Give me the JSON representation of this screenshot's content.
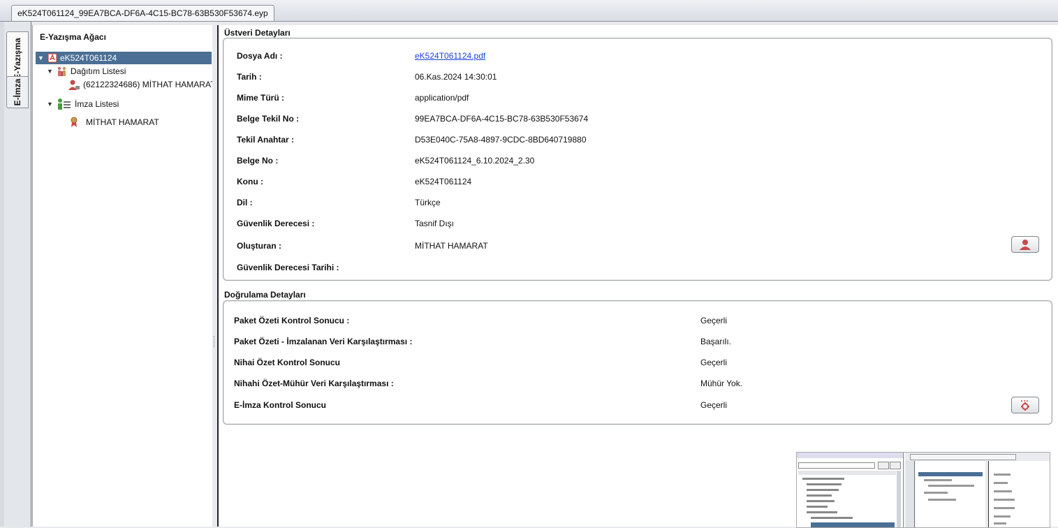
{
  "window": {
    "file_tab": "eK524T061124_99EA7BCA-DF6A-4C15-BC78-63B530F53674.eyp"
  },
  "side_tabs": [
    "E-Yazışma",
    "E-İmza"
  ],
  "tree": {
    "title": "E-Yazışma Ağacı",
    "root": "eK524T061124",
    "distribution_list": "Dağıtım Listesi",
    "distribution_item": "(62122324686) MİTHAT HAMARAT",
    "signature_list": "İmza Listesi",
    "signature_item": "MİTHAT HAMARAT"
  },
  "metadata": {
    "title": "Üstveri Detayları",
    "rows": [
      {
        "label": "Dosya Adı :",
        "value": "eK524T061124.pdf",
        "link": true
      },
      {
        "label": "Tarih :",
        "value": "06.Kas.2024 14:30:01"
      },
      {
        "label": "Mime Türü :",
        "value": "application/pdf"
      },
      {
        "label": "Belge Tekil No :",
        "value": "99EA7BCA-DF6A-4C15-BC78-63B530F53674"
      },
      {
        "label": "Tekil Anahtar :",
        "value": "D53E040C-75A8-4897-9CDC-8BD640719880"
      },
      {
        "label": "Belge No :",
        "value": "eK524T061124_6.10.2024_2.30"
      },
      {
        "label": "Konu :",
        "value": "eK524T061124"
      },
      {
        "label": "Dil :",
        "value": "Türkçe"
      },
      {
        "label": "Güvenlik Derecesi :",
        "value": "Tasnif Dışı"
      },
      {
        "label": "Oluşturan :",
        "value": "MİTHAT HAMARAT"
      },
      {
        "label": "Güvenlik Derecesi Tarihi :",
        "value": ""
      }
    ]
  },
  "verification": {
    "title": "Doğrulama Detayları",
    "rows": [
      {
        "label": "Paket Özeti Kontrol Sonucu :",
        "value": "Geçerli"
      },
      {
        "label": "Paket Özeti - İmzalanan Veri Karşılaştırması :",
        "value": "Başarılı."
      },
      {
        "label": "Nihai Özet Kontrol Sonucu",
        "value": "Geçerli"
      },
      {
        "label": "Nihahi Özet-Mühür Veri Karşılaştırması :",
        "value": "Mühür Yok."
      },
      {
        "label": "E-İmza Kontrol Sonucu",
        "value": "Geçerli"
      }
    ]
  },
  "icons": {
    "pdf": "pdf-icon",
    "group": "group-icon",
    "person": "person-icon",
    "signature_list": "signature-list-icon",
    "seal": "seal-icon",
    "creator_button": "person-icon",
    "signature_button": "gear-icon"
  },
  "colors": {
    "selection": "#4b6f95",
    "link": "#1a3fd6"
  }
}
